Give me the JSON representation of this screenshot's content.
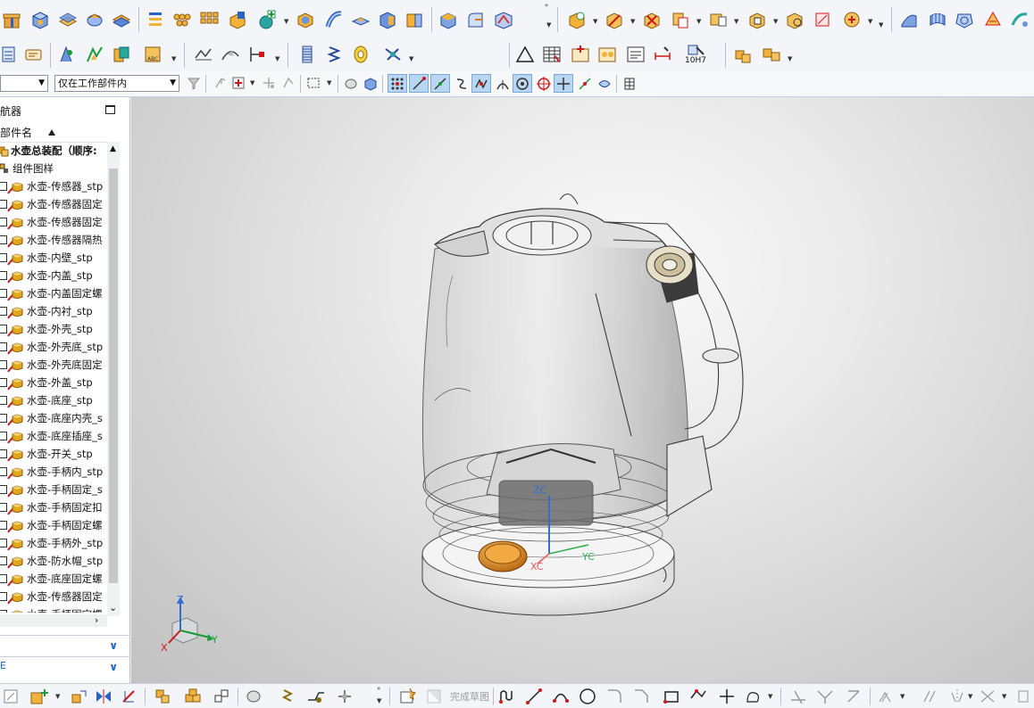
{
  "toolbar": {
    "scope_filter": {
      "value": "",
      "placeholder": ""
    },
    "selection_scope": {
      "value": "仅在工作部件内"
    },
    "fit_label": "10H7"
  },
  "navigator": {
    "title": "航器",
    "column_header": "部件名",
    "root": "水壶总装配（顺序:",
    "constraints": "组件图样",
    "items": [
      "水壶-传感器_stp",
      "水壶-传感器固定",
      "水壶-传感器固定",
      "水壶-传感器隔热",
      "水壶-内壁_stp",
      "水壶-内盖_stp",
      "水壶-内盖固定螺",
      "水壶-内衬_stp",
      "水壶-外壳_stp",
      "水壶-外壳底_stp",
      "水壶-外壳底固定",
      "水壶-外盖_stp",
      "水壶-底座_stp",
      "水壶-底座内壳_s",
      "水壶-底座插座_s",
      "水壶-开关_stp",
      "水壶-手柄内_stp",
      "水壶-手柄固定_s",
      "水壶-手柄固定扣",
      "水壶-手柄固定螺",
      "水壶-手柄外_stp",
      "水壶-防水帽_stp",
      "水壶-底座固定螺",
      "水壶-传感器固定",
      "水壶-手柄固定螺"
    ],
    "bottom_panel_2_label": "E"
  },
  "viewport": {
    "wcs": {
      "z": "ZC",
      "y": "YC",
      "x": "XC"
    },
    "triad": {
      "z": "Z",
      "y": "Y",
      "x": "X"
    }
  },
  "sketch_toolbar": {
    "finish_label": "完成草图"
  },
  "colors": {
    "accent_blue": "#1d64c8",
    "check_red": "#d01818",
    "part_gold": "#e0a91c"
  }
}
